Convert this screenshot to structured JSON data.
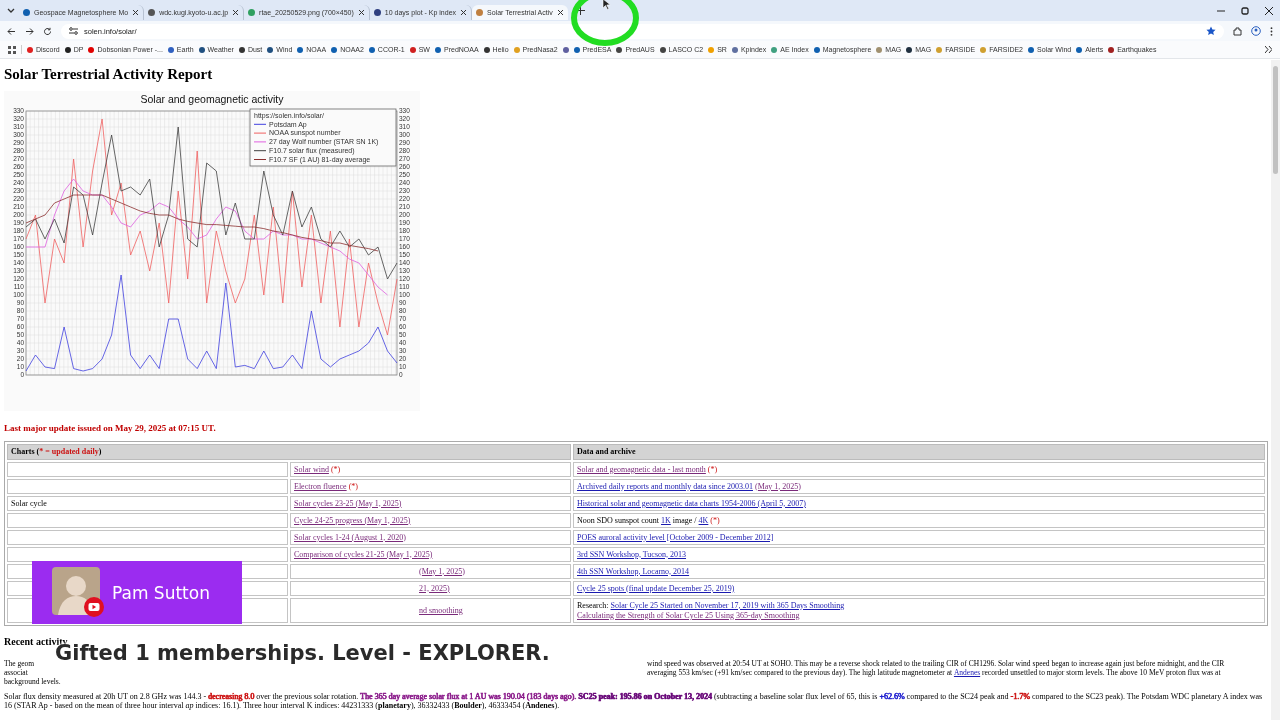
{
  "browser": {
    "tabs": [
      {
        "title": "Geospace Magnetosphere Mo",
        "selected": false,
        "color": "#1060b0"
      },
      {
        "title": "wdc.kugi.kyoto-u.ac.jp",
        "selected": false,
        "color": "#555555"
      },
      {
        "title": "rtae_20250529.png (700×450)",
        "selected": false,
        "color": "#30a060"
      },
      {
        "title": "10 days plot - Kp index",
        "selected": false,
        "color": "#304080"
      },
      {
        "title": "Solar Terrestrial Activ",
        "selected": true,
        "color": "#c08040"
      }
    ],
    "url": "solen.info/solar/",
    "bookmarks": [
      {
        "label": "Discord",
        "color": "#e02020"
      },
      {
        "label": "DP",
        "color": "#222222"
      },
      {
        "label": "Dobsonian Power -...",
        "color": "#e00000"
      },
      {
        "label": "Earth",
        "color": "#3060c0"
      },
      {
        "label": "Weather",
        "color": "#205080"
      },
      {
        "label": "Dust",
        "color": "#333333"
      },
      {
        "label": "Wind",
        "color": "#205080"
      },
      {
        "label": "NOAA",
        "color": "#1060b0"
      },
      {
        "label": "NOAA2",
        "color": "#1060b0"
      },
      {
        "label": "CCOR-1",
        "color": "#1060b0"
      },
      {
        "label": "SW",
        "color": "#d02020"
      },
      {
        "label": "PredNOAA",
        "color": "#1060b0"
      },
      {
        "label": "Helio",
        "color": "#333333"
      },
      {
        "label": "PredNasa2",
        "color": "#e0a020"
      },
      {
        "color": "#6060a0"
      },
      {
        "label": "PredESA",
        "color": "#1060b0"
      },
      {
        "label": "PredAUS",
        "color": "#444444"
      },
      {
        "label": "LASCO C2",
        "color": "#444444"
      },
      {
        "label": "SR",
        "color": "#f0a000"
      },
      {
        "label": "Kpindex",
        "color": "#6070a0"
      },
      {
        "label": "AE Index",
        "color": "#40a080"
      },
      {
        "label": "Magnetosphere",
        "color": "#1060b0"
      },
      {
        "label": "MAG",
        "color": "#a09070"
      },
      {
        "label": "MAG",
        "color": "#203040"
      },
      {
        "label": "FARSIDE",
        "color": "#d0a030"
      },
      {
        "label": "FARSIDE2",
        "color": "#d0a030"
      },
      {
        "label": "Solar Wind",
        "color": "#1060b0"
      },
      {
        "label": "Alerts",
        "color": "#1060b0"
      },
      {
        "label": "Earthquakes",
        "color": "#a02020"
      }
    ]
  },
  "page": {
    "title": "Solar Terrestrial Activity Report",
    "chart": {
      "source": "https://solen.info/solar/",
      "right_axis_ticks": [
        "330",
        "320",
        "310",
        "300",
        "290",
        "280",
        "270",
        "260",
        "250",
        "240",
        "230",
        "220",
        "210",
        "200",
        "190",
        "180",
        "170",
        "160",
        "150",
        "140",
        "130",
        "120",
        "110",
        "100",
        "90",
        "80",
        "70",
        "60",
        "50",
        "40",
        "30",
        "20",
        "10",
        "0"
      ],
      "chart_data": {
        "type": "line",
        "title": "Solar and geomagnetic activity",
        "ylim": [
          0,
          330
        ],
        "grid": true,
        "legend": true,
        "yticks": [
          0,
          10,
          20,
          30,
          40,
          50,
          60,
          70,
          80,
          90,
          100,
          110,
          120,
          130,
          140,
          150,
          160,
          170,
          180,
          190,
          200,
          210,
          220,
          230,
          240,
          250,
          260,
          270,
          280,
          290,
          300,
          310,
          320,
          330
        ],
        "series": [
          {
            "name": "Potsdam Ap",
            "color": "#4040e0",
            "values": [
              5,
              25,
              10,
              8,
              60,
              8,
              5,
              8,
              20,
              50,
              125,
              25,
              8,
              25,
              8,
              70,
              70,
              20,
              8,
              30,
              8,
              115,
              10,
              12,
              8,
              30,
              8,
              10,
              25,
              8,
              80,
              20,
              10,
              20,
              25,
              30,
              40,
              60,
              30,
              15
            ]
          },
          {
            "name": "NOAA sunspot number",
            "color": "#f06060",
            "values": [
              170,
              200,
              90,
              170,
              140,
              270,
              160,
              255,
              320,
              200,
              240,
              150,
              180,
              130,
              190,
              90,
              230,
              120,
              280,
              90,
              180,
              130,
              90,
              120,
              200,
              100,
              210,
              90,
              230,
              110,
              200,
              90,
              180,
              60,
              170,
              60,
              140,
              90,
              50,
              120
            ]
          },
          {
            "name": "27 day Wolf number (STAR SN 1K)",
            "color": "#e060e0",
            "values": [
              160,
              160,
              160,
              200,
              230,
              245,
              230,
              225,
              225,
              210,
              190,
              185,
              200,
              205,
              215,
              210,
              195,
              185,
              170,
              175,
              195,
              210,
              205,
              180,
              170,
              170,
              180,
              175,
              175,
              170,
              170,
              165,
              160,
              155,
              145,
              140,
              125,
              110,
              100,
              null
            ]
          },
          {
            "name": "F10.7 solar flux (measured)",
            "color": "#404040",
            "values": [
              185,
              195,
              170,
              195,
              165,
              235,
              225,
              175,
              240,
              300,
              230,
              235,
              225,
              245,
              160,
              200,
              310,
              170,
              160,
              265,
              255,
              175,
              215,
              170,
              170,
              255,
              200,
              175,
              230,
              185,
              210,
              170,
              160,
              180,
              160,
              170,
              150,
              160,
              120,
              140
            ]
          },
          {
            "name": "F10.7 SF (1 AU) 81-day average",
            "color": "#8b3030",
            "values": [
              190,
              195,
              200,
              215,
              220,
              225,
              225,
              225,
              225,
              220,
              215,
              210,
              205,
              202,
              200,
              200,
              195,
              192,
              190,
              188,
              188,
              187,
              186,
              185,
              185,
              183,
              180,
              178,
              175,
              172,
              170,
              168,
              165,
              165,
              162,
              160,
              158,
              155,
              null,
              null
            ]
          }
        ]
      }
    },
    "update_notice": "Last major update issued on May 29, 2025 at 07:15 UT.",
    "table": {
      "charts_heading": [
        {
          "kind": "text",
          "text": "Charts ("
        },
        {
          "kind": "note",
          "text": "* = updated daily"
        },
        {
          "kind": "text",
          "text": ")"
        }
      ],
      "data_heading": "Data and archive",
      "rows": [
        {
          "chart": {
            "parts": [
              {
                "kind": "link",
                "text": "Solar wind",
                "visited": true
              },
              {
                "kind": "note",
                "text": "(*)"
              }
            ]
          },
          "data": {
            "parts": [
              {
                "kind": "link",
                "text": "Solar and geomagnetic data - last month",
                "visited": true
              },
              {
                "kind": "note",
                "text": "(*)"
              }
            ]
          }
        },
        {
          "chart": {
            "parts": [
              {
                "kind": "link",
                "text": "Electron fluence",
                "visited": true
              },
              {
                "kind": "note",
                "text": "(*)"
              }
            ]
          },
          "data": {
            "parts": [
              {
                "kind": "link",
                "text": "Archived daily reports and monthly data since 2003.01",
                "visited": false
              },
              {
                "kind": "link",
                "text": "(May 1, 2025)",
                "visited": true
              }
            ]
          }
        },
        {
          "label": "Solar cycle",
          "chart": {
            "parts": [
              {
                "kind": "link",
                "text": "Solar cycles 23-25 (May 1, 2025)",
                "visited": true
              }
            ]
          },
          "data": {
            "parts": [
              {
                "kind": "link",
                "text": "Historical solar and geomagnetic data charts 1954-2006 (April 5, 2007)",
                "visited": false
              }
            ]
          }
        },
        {
          "chart": {
            "parts": [
              {
                "kind": "link",
                "text": "Cycle 24-25 progress (May 1, 2025)",
                "visited": true
              }
            ]
          },
          "data": {
            "parts": [
              {
                "kind": "text",
                "text": "Noon SDO sunspot count"
              },
              {
                "kind": "link",
                "text": "1K",
                "visited": false
              },
              {
                "kind": "text",
                "text": "image /"
              },
              {
                "kind": "link",
                "text": "4K",
                "visited": false
              },
              {
                "kind": "note",
                "text": "(*)"
              }
            ]
          }
        },
        {
          "chart": {
            "parts": [
              {
                "kind": "link",
                "text": "Solar cycles 1-24 (August 1, 2020)",
                "visited": true
              }
            ]
          },
          "data": {
            "parts": [
              {
                "kind": "link",
                "text": "POES auroral activity level [October 2009 - December 2012]",
                "visited": false
              }
            ]
          }
        },
        {
          "chart": {
            "covered": false,
            "parts": [
              {
                "kind": "link",
                "text": "Comparison of cycles 21-25 (May 1, 2025)",
                "visited": true
              }
            ]
          },
          "data": {
            "parts": [
              {
                "kind": "link",
                "text": "3rd SSN Workshop, Tucson, 2013",
                "visited": false
              }
            ]
          }
        },
        {
          "chart": {
            "covered": true,
            "parts": [
              {
                "kind": "link",
                "text": "(May 1, 2025)",
                "visited": true
              }
            ]
          },
          "data": {
            "parts": [
              {
                "kind": "link",
                "text": "4th SSN Workshop, Locarno, 2014",
                "visited": false
              }
            ]
          }
        },
        {
          "chart": {
            "covered": true,
            "parts": [
              {
                "kind": "link",
                "text": "21, 2025)",
                "visited": true
              }
            ]
          },
          "data": {
            "parts": [
              {
                "kind": "link",
                "text": "Cycle 25 spots (final update December 25, 2019)",
                "visited": false
              }
            ]
          }
        },
        {
          "chart": {
            "covered": true,
            "parts": [
              {
                "kind": "link",
                "text": "nd smoothing",
                "visited": true
              }
            ]
          },
          "data": {
            "parts": [
              {
                "kind": "text",
                "text": "Research:"
              },
              {
                "kind": "link",
                "text": "Solar Cycle 25 Started on November 17, 2019 with 365 Days Smoothing",
                "visited": false
              },
              {
                "kind": "break"
              },
              {
                "kind": "link",
                "text": "Calculating the Strength of Solar Cycle 25 Using 365-day Smoothing",
                "visited": true
              }
            ]
          }
        }
      ]
    },
    "recent_heading": "Recent activity",
    "activity_lines": [
      {
        "left": "The geom",
        "right": [
          {
            "kind": "text",
            "text": "wind speed was observed at 20:54 UT at SOHO. This may be a reverse shock related to the trailing CIR of CH1296. Solar wind speed began to increase again just before midnight, and the CIR"
          }
        ]
      },
      {
        "left": "associat",
        "right": [
          {
            "kind": "text",
            "text": "averaging 553 km/sec (+91 km/sec compared to the previous day). The high latitude magnetometer at"
          },
          {
            "kind": "link",
            "text": "Andenes",
            "visited": false
          },
          {
            "kind": "text",
            "text": "recorded unsettled to major storm levels. The above 10 MeV proton flux was at"
          }
        ]
      },
      {
        "left": "background levels."
      }
    ],
    "flux_paragraph": [
      {
        "text": "Solar flux density measured at 20h UT on 2.8 GHz was 144.3 - "
      },
      {
        "text": "decreasing 8.0",
        "color": "#cc1010"
      },
      {
        "text": " over the previous solar rotation. "
      },
      {
        "text": "The 365 day average solar flux at 1 AU was 190.04 (183 days ago). ",
        "color": "#8a1a8a"
      },
      {
        "text": "**SC25 peak: 195.86 on October 13, 2024**",
        "color": "#6a0a7a"
      },
      {
        "text": " (subtracting a baseline solar flux level of 65, this is "
      },
      {
        "text": "+62.6%",
        "color": "#2020d0"
      },
      {
        "text": " compared to the SC24 peak and "
      },
      {
        "text": "-1.7%",
        "color": "#cc1010"
      },
      {
        "text": " compared to the SC23 peak). The Potsdam WDC planetary A index was 16 (STAR Ap - based on the mean of three hour interval *ap* indices: 16.1). Three hour interval K indices: 44231333 (**planetary**), 36332433 (**Boulder**), 46333454 (**Andenes**)."
      }
    ]
  },
  "stream_overlay": {
    "name": "Pam Sutton",
    "banner": "Gifted 1 memberships. Level - EXPLORER."
  }
}
